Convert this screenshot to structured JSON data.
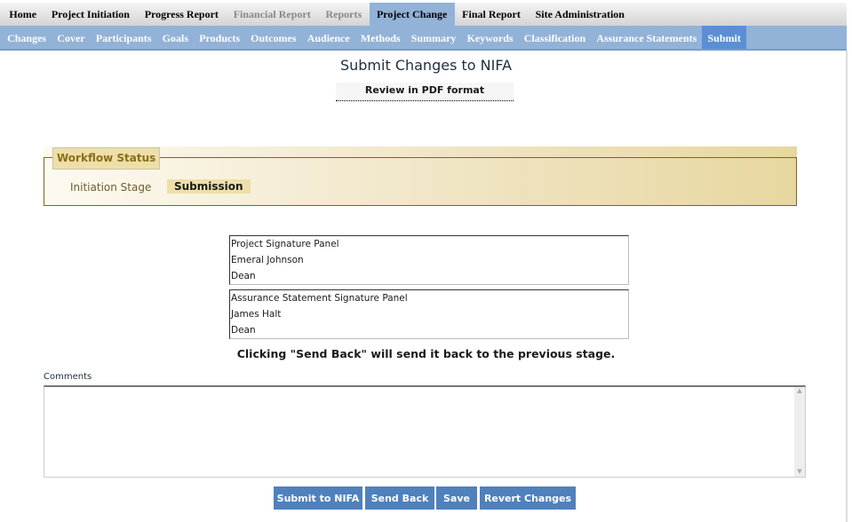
{
  "top_nav": [
    {
      "label": "Home",
      "state": "normal"
    },
    {
      "label": "Project Initiation",
      "state": "normal"
    },
    {
      "label": "Progress Report",
      "state": "normal"
    },
    {
      "label": "Financial Report",
      "state": "disabled"
    },
    {
      "label": "Reports",
      "state": "disabled"
    },
    {
      "label": "Project Change",
      "state": "active"
    },
    {
      "label": "Final Report",
      "state": "normal"
    },
    {
      "label": "Site Administration",
      "state": "normal"
    }
  ],
  "sub_nav": [
    "Changes",
    "Cover",
    "Participants",
    "Goals",
    "Products",
    "Outcomes",
    "Audience",
    "Methods",
    "Summary",
    "Keywords",
    "Classification",
    "Assurance Statements",
    "Submit"
  ],
  "sub_nav_active": "Submit",
  "page_title": "Submit Changes to NIFA",
  "pdf_link": "Review in PDF format",
  "workflow": {
    "legend": "Workflow Status",
    "stages": [
      "Initiation Stage",
      "Submission"
    ]
  },
  "panels": [
    {
      "title": "Project Signature Panel",
      "name": "Emeral Johnson",
      "role": "Dean"
    },
    {
      "title": "Assurance Statement Signature Panel",
      "name": "James Halt",
      "role": "Dean"
    }
  ],
  "note": "Clicking \"Send Back\" will send it back to the previous stage.",
  "comments": {
    "label": "Comments",
    "value": ""
  },
  "buttons": {
    "submit": "Submit to NIFA",
    "send_back": "Send Back",
    "save": "Save",
    "revert": "Revert Changes"
  },
  "colors": {
    "nav_blue": "#92b2d8",
    "active_blue": "#5a8fd6",
    "button_blue": "#4f81bd",
    "workflow_gold": "#eedfa9"
  }
}
